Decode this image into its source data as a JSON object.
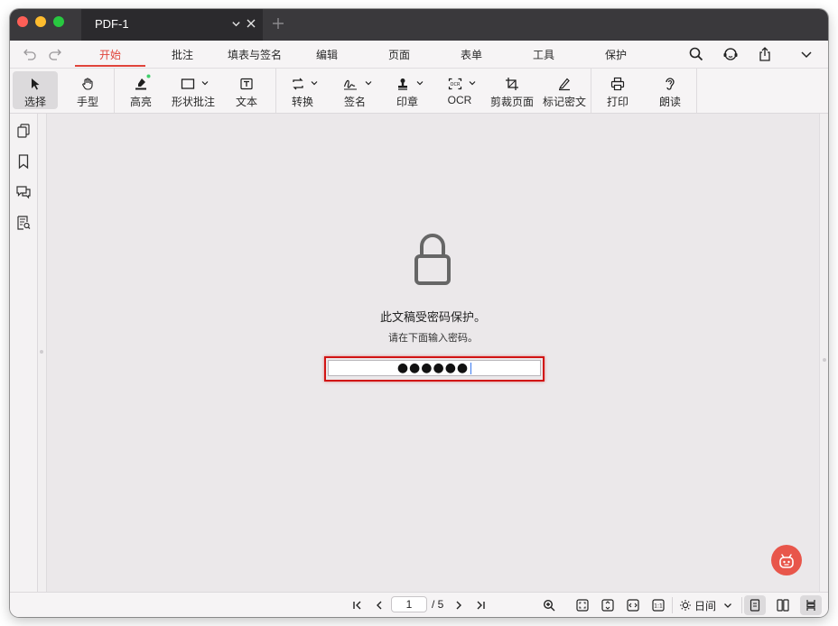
{
  "tab": {
    "title": "PDF-1"
  },
  "menu": {
    "items": [
      {
        "label": "开始",
        "active": true
      },
      {
        "label": "批注"
      },
      {
        "label": "填表与签名"
      },
      {
        "label": "编辑"
      },
      {
        "label": "页面"
      },
      {
        "label": "表单"
      },
      {
        "label": "工具"
      },
      {
        "label": "保护"
      }
    ]
  },
  "toolbar": {
    "items": [
      {
        "label": "选择",
        "icon": "cursor-icon",
        "selected": true
      },
      {
        "label": "手型",
        "icon": "hand-icon"
      },
      {
        "label": "高亮",
        "icon": "highlighter-icon"
      },
      {
        "label": "形状批注",
        "icon": "rectangle-icon"
      },
      {
        "label": "文本",
        "icon": "text-box-icon"
      },
      {
        "label": "转换",
        "icon": "convert-icon"
      },
      {
        "label": "签名",
        "icon": "signature-icon"
      },
      {
        "label": "印章",
        "icon": "stamp-icon"
      },
      {
        "label": "OCR",
        "icon": "ocr-icon"
      },
      {
        "label": "剪裁页面",
        "icon": "crop-icon"
      },
      {
        "label": "标记密文",
        "icon": "redact-icon"
      },
      {
        "label": "打印",
        "icon": "printer-icon"
      },
      {
        "label": "朗读",
        "icon": "ear-icon"
      }
    ]
  },
  "document": {
    "message": "此文稿受密码保护。",
    "prompt": "请在下面输入密码。",
    "password_value": "●●●●●●"
  },
  "status": {
    "current_page": "1",
    "page_total": "/ 5",
    "theme": "日间"
  },
  "colors": {
    "accent": "#e0443a",
    "highlight_border": "#d11414",
    "titlebar": "#3a393c"
  }
}
